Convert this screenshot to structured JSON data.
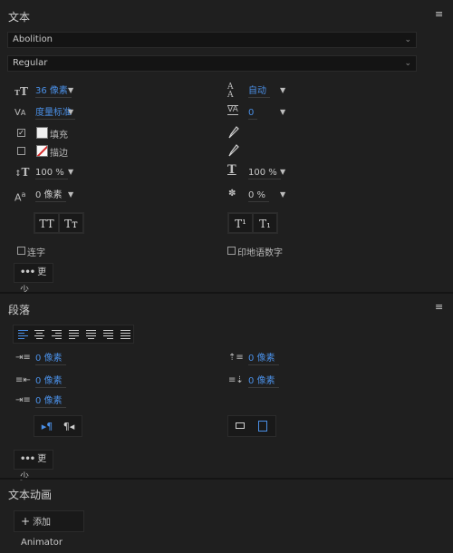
{
  "text_panel": {
    "title": "文本",
    "font_family": "Abolition",
    "font_style": "Regular",
    "font_size": "36 像素",
    "leading": "自动",
    "kerning": "度量标准",
    "tracking": "0",
    "fill_label": "填充",
    "stroke_label": "描边",
    "vertical_scale": "100 %",
    "horizontal_scale": "100 %",
    "baseline_shift": "0 像素",
    "tsume": "0 %",
    "all_caps": "TT",
    "small_caps": "Tт",
    "superscript": "T¹",
    "subscript": "T₁",
    "ligatures_label": "连字",
    "hindi_digits_label": "印地语数字",
    "more_label": "更少"
  },
  "paragraph_panel": {
    "title": "段落",
    "indent_left": "0 像素",
    "space_before": "0 像素",
    "indent_right": "0 像素",
    "space_after": "0 像素",
    "first_line_indent": "0 像素",
    "more_label": "更少"
  },
  "animation_panel": {
    "title": "文本动画",
    "add_animator_label": "添加 Animator"
  },
  "icons": {
    "panel_menu": "≡",
    "plus": "+",
    "dots": "•••"
  },
  "colors": {
    "accent": "#4a8fe6",
    "background": "#1f1f1f",
    "stroke_slash": "#d62828"
  }
}
